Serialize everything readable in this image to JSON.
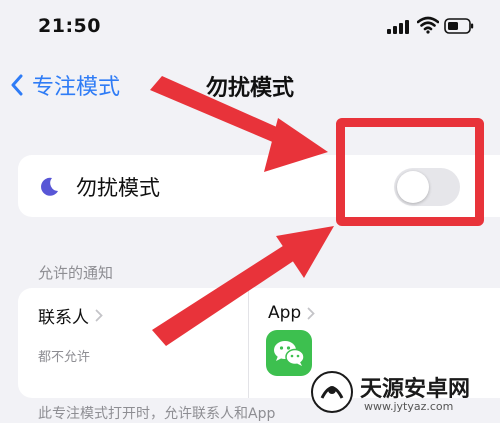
{
  "status_bar": {
    "time": "21:50"
  },
  "nav": {
    "back_label": "专注模式",
    "title": "勿扰模式"
  },
  "dnd": {
    "label": "勿扰模式",
    "toggle_state": "off"
  },
  "allowed_notifications": {
    "header": "允许的通知",
    "contacts_label": "联系人",
    "contacts_subtitle": "都不允许",
    "app_label": "App",
    "app_icon": "wechat-icon"
  },
  "footer": {
    "text": "此专注模式打开时，允许联系人和App"
  },
  "overlay": {
    "color": "#e8333a"
  },
  "watermark": {
    "title": "天源安卓网",
    "url": "www.jytyaz.com"
  },
  "colors": {
    "accent": "#2f7cf6",
    "moon": "#5856d6",
    "wechat": "#3dc04f"
  }
}
